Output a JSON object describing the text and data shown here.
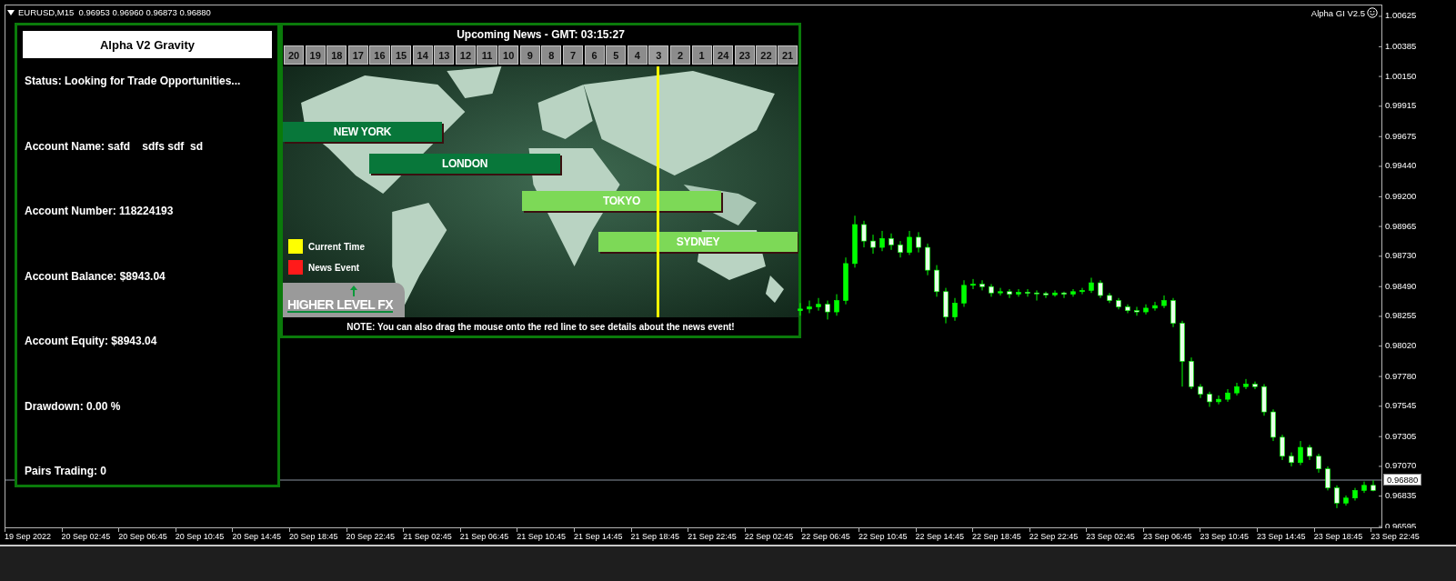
{
  "chart": {
    "symbol_info": "EURUSD,M15  0.96953 0.96960 0.96873 0.96880",
    "indicator_label": "Alpha GI V2.5",
    "current_price": "0.96880",
    "time_ticks": [
      "19 Sep 2022",
      "20 Sep 02:45",
      "20 Sep 06:45",
      "20 Sep 10:45",
      "20 Sep 14:45",
      "20 Sep 18:45",
      "20 Sep 22:45",
      "21 Sep 02:45",
      "21 Sep 06:45",
      "21 Sep 10:45",
      "21 Sep 14:45",
      "21 Sep 18:45",
      "21 Sep 22:45",
      "22 Sep 02:45",
      "22 Sep 06:45",
      "22 Sep 10:45",
      "22 Sep 14:45",
      "22 Sep 18:45",
      "22 Sep 22:45",
      "23 Sep 02:45",
      "23 Sep 06:45",
      "23 Sep 10:45",
      "23 Sep 14:45",
      "23 Sep 18:45",
      "23 Sep 22:45"
    ],
    "chart_data": {
      "type": "candlestick",
      "ylim": [
        0.96581,
        1.00711
      ],
      "yticks": [
        {
          "value": 1.00625,
          "label": "1.00625"
        },
        {
          "value": 1.00385,
          "label": "1.00385"
        },
        {
          "value": 1.0015,
          "label": "1.00150"
        },
        {
          "value": 0.99915,
          "label": "0.99915"
        },
        {
          "value": 0.99675,
          "label": "0.99675"
        },
        {
          "value": 0.9944,
          "label": "0.99440"
        },
        {
          "value": 0.992,
          "label": "0.99200"
        },
        {
          "value": 0.98965,
          "label": "0.98965"
        },
        {
          "value": 0.9873,
          "label": "0.98730"
        },
        {
          "value": 0.9849,
          "label": "0.98490"
        },
        {
          "value": 0.98255,
          "label": "0.98255"
        },
        {
          "value": 0.9802,
          "label": "0.98020"
        },
        {
          "value": 0.9778,
          "label": "0.97780"
        },
        {
          "value": 0.97545,
          "label": "0.97545"
        },
        {
          "value": 0.97305,
          "label": "0.97305"
        },
        {
          "value": 0.9707,
          "label": "0.97070"
        },
        {
          "value": 0.96835,
          "label": "0.96835"
        },
        {
          "value": 0.96595,
          "label": "0.96595"
        }
      ],
      "categories": [
        null,
        null,
        null,
        null,
        null,
        null,
        null,
        null,
        null,
        null,
        null,
        null,
        null,
        null,
        null,
        null,
        null,
        null,
        null,
        null,
        null,
        null,
        null,
        null,
        null,
        null,
        null,
        null,
        null,
        null,
        null,
        null,
        null,
        null,
        null,
        null,
        null,
        null,
        null,
        null,
        null,
        null,
        null,
        null,
        null,
        null,
        null,
        null,
        null,
        null,
        null,
        null,
        null,
        null,
        null,
        null,
        null,
        null,
        null,
        null,
        null,
        null,
        null,
        null
      ],
      "ohlc": [
        [
          0.983,
          0.9836,
          0.9826,
          0.98313
        ],
        [
          0.98313,
          0.9838,
          0.9828,
          0.9833
        ],
        [
          0.9833,
          0.984,
          0.983,
          0.9835
        ],
        [
          0.9835,
          0.9838,
          0.9823,
          0.9829
        ],
        [
          0.9829,
          0.9843,
          0.9826,
          0.9838
        ],
        [
          0.9838,
          0.9872,
          0.9835,
          0.98672
        ],
        [
          0.98672,
          0.9905,
          0.9864,
          0.9898
        ],
        [
          0.9898,
          0.9901,
          0.988,
          0.9885
        ],
        [
          0.9885,
          0.989,
          0.9875,
          0.988
        ],
        [
          0.988,
          0.9893,
          0.9877,
          0.9887
        ],
        [
          0.9887,
          0.9891,
          0.9878,
          0.9882
        ],
        [
          0.9882,
          0.9885,
          0.9872,
          0.9876
        ],
        [
          0.9876,
          0.9893,
          0.9874,
          0.9888
        ],
        [
          0.9888,
          0.9892,
          0.9876,
          0.988
        ],
        [
          0.988,
          0.9883,
          0.9858,
          0.9862
        ],
        [
          0.9862,
          0.9866,
          0.9841,
          0.9845
        ],
        [
          0.9845,
          0.9848,
          0.982,
          0.9825
        ],
        [
          0.9825,
          0.984,
          0.9822,
          0.9836
        ],
        [
          0.9836,
          0.9854,
          0.9833,
          0.985
        ],
        [
          0.985,
          0.9855,
          0.9847,
          0.9851
        ],
        [
          0.9851,
          0.9854,
          0.9846,
          0.9849
        ],
        [
          0.9849,
          0.9851,
          0.9841,
          0.9844
        ],
        [
          0.9844,
          0.9848,
          0.9842,
          0.9845
        ],
        [
          0.9845,
          0.9847,
          0.984,
          0.9843
        ],
        [
          0.9843,
          0.9847,
          0.9841,
          0.98445
        ],
        [
          0.98445,
          0.9847,
          0.9841,
          0.9844
        ],
        [
          0.9844,
          0.9846,
          0.9838,
          0.98435
        ],
        [
          0.98435,
          0.9845,
          0.984,
          0.98425
        ],
        [
          0.98425,
          0.9846,
          0.9841,
          0.9844
        ],
        [
          0.9844,
          0.9845,
          0.984,
          0.9843
        ],
        [
          0.9843,
          0.9847,
          0.9841,
          0.9845
        ],
        [
          0.9845,
          0.9848,
          0.9843,
          0.9846
        ],
        [
          0.9846,
          0.9856,
          0.9844,
          0.9852
        ],
        [
          0.9852,
          0.9854,
          0.984,
          0.9842
        ],
        [
          0.9842,
          0.9844,
          0.9836,
          0.9838
        ],
        [
          0.9838,
          0.984,
          0.9831,
          0.9833
        ],
        [
          0.9833,
          0.9835,
          0.9828,
          0.983
        ],
        [
          0.983,
          0.9833,
          0.9826,
          0.9829
        ],
        [
          0.9829,
          0.9835,
          0.9827,
          0.9832
        ],
        [
          0.9832,
          0.9837,
          0.983,
          0.9834
        ],
        [
          0.9834,
          0.9842,
          0.9832,
          0.9838
        ],
        [
          0.9838,
          0.984,
          0.9817,
          0.982
        ],
        [
          0.982,
          0.9822,
          0.977,
          0.979
        ],
        [
          0.979,
          0.9793,
          0.9768,
          0.977
        ],
        [
          0.977,
          0.9772,
          0.9761,
          0.9764
        ],
        [
          0.9764,
          0.9766,
          0.9754,
          0.9758
        ],
        [
          0.9758,
          0.9763,
          0.9756,
          0.976
        ],
        [
          0.976,
          0.9768,
          0.9758,
          0.9765
        ],
        [
          0.9765,
          0.9773,
          0.9763,
          0.977
        ],
        [
          0.977,
          0.9776,
          0.9768,
          0.9772
        ],
        [
          0.9772,
          0.9774,
          0.9768,
          0.977
        ],
        [
          0.977,
          0.9772,
          0.9747,
          0.975
        ],
        [
          0.975,
          0.9752,
          0.9727,
          0.973
        ],
        [
          0.973,
          0.9732,
          0.9712,
          0.9715
        ],
        [
          0.9715,
          0.9718,
          0.9707,
          0.971
        ],
        [
          0.971,
          0.9727,
          0.9708,
          0.9722
        ],
        [
          0.9722,
          0.9724,
          0.9712,
          0.9715
        ],
        [
          0.9715,
          0.9717,
          0.9702,
          0.9705
        ],
        [
          0.9705,
          0.9707,
          0.9688,
          0.969
        ],
        [
          0.969,
          0.9692,
          0.9674,
          0.9678
        ],
        [
          0.9678,
          0.9684,
          0.9676,
          0.9682
        ],
        [
          0.9682,
          0.969,
          0.968,
          0.9688
        ],
        [
          0.9688,
          0.9695,
          0.9686,
          0.9692
        ],
        [
          0.9692,
          0.9696,
          0.96873,
          0.9688
        ]
      ]
    }
  },
  "info_panel": {
    "title": "Alpha V2 Gravity",
    "lines": [
      "Status: Looking for Trade Opportunities...",
      "Account Name: safd    sdfs sdf  sd",
      "Account Number: 118224193",
      "Account Balance: $8943.04",
      "Account Equity: $8943.04",
      "Drawdown: 0.00 %",
      "Pairs Trading: 0"
    ]
  },
  "news_panel": {
    "title": "Upcoming News - GMT: 03:15:27",
    "hours": [
      {
        "label": "20",
        "current": false
      },
      {
        "label": "19",
        "current": false
      },
      {
        "label": "18",
        "current": false
      },
      {
        "label": "17",
        "current": false
      },
      {
        "label": "16",
        "current": false
      },
      {
        "label": "15",
        "current": false
      },
      {
        "label": "14",
        "current": false
      },
      {
        "label": "13",
        "current": false
      },
      {
        "label": "12",
        "current": false
      },
      {
        "label": "11",
        "current": false
      },
      {
        "label": "10",
        "current": false
      },
      {
        "label": "9",
        "current": false
      },
      {
        "label": "8",
        "current": false
      },
      {
        "label": "7",
        "current": false
      },
      {
        "label": "6",
        "current": false
      },
      {
        "label": "5",
        "current": false
      },
      {
        "label": "4",
        "current": false
      },
      {
        "label": "3",
        "current": true
      },
      {
        "label": "2",
        "current": false
      },
      {
        "label": "1",
        "current": false
      },
      {
        "label": "24",
        "current": false
      },
      {
        "label": "23",
        "current": false
      },
      {
        "label": "22",
        "current": false
      },
      {
        "label": "21",
        "current": false
      }
    ],
    "sessions": [
      {
        "label": "NEW YORK",
        "color": "#08773a"
      },
      {
        "label": "LONDON",
        "color": "#08773a"
      },
      {
        "label": "TOKYO",
        "color": "#7dd957"
      },
      {
        "label": "SYDNEY",
        "color": "#7dd957"
      }
    ],
    "legend": [
      {
        "label": "Current Time",
        "color": "#ffff00"
      },
      {
        "label": "News Event",
        "color": "#ff1a1a"
      }
    ],
    "logo": "HIGHER LEVEL FX",
    "note": "NOTE: You can also drag the mouse onto the red line to see details about the news event!"
  }
}
